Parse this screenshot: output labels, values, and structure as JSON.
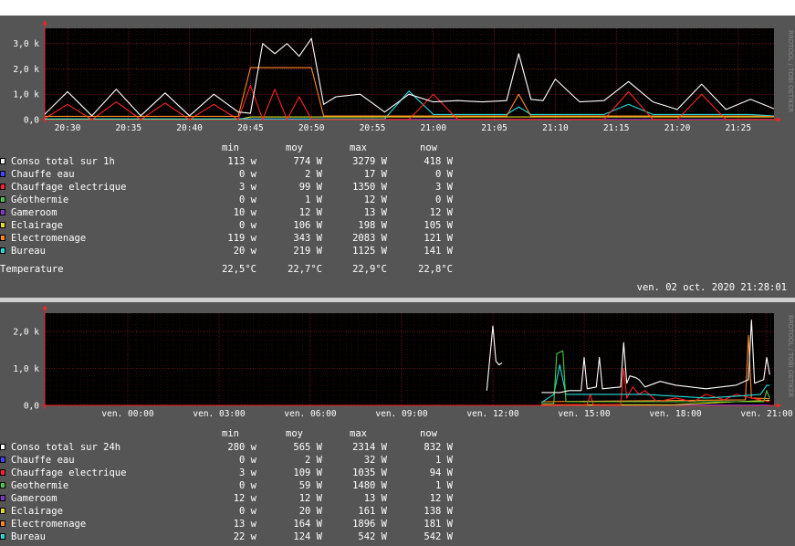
{
  "graphs": [
    {
      "id": "1h",
      "y_ticks": [
        "3,0 k",
        "2,0 k",
        "1,0 k",
        "0,0"
      ],
      "x_ticks": [
        "20:30",
        "20:35",
        "20:40",
        "20:45",
        "20:50",
        "20:55",
        "21:00",
        "21:05",
        "21:10",
        "21:15",
        "21:20",
        "21:25"
      ],
      "side_text": "RRDTOOL / TOBI OETIKER",
      "columns": [
        "min",
        "moy",
        "max",
        "now"
      ],
      "rows": [
        {
          "name": "Conso total sur 1h",
          "color": "#ffffff",
          "min": "113 w",
          "moy": "774 W",
          "max": "3279 W",
          "now": "418 W"
        },
        {
          "name": "Chauffe eau",
          "color": "#4444ff",
          "min": "0 w",
          "moy": "2 W",
          "max": "17 W",
          "now": "0 W"
        },
        {
          "name": "Chauffage electrique",
          "color": "#ff2222",
          "min": "3 w",
          "moy": "99 W",
          "max": "1350 W",
          "now": "3 W"
        },
        {
          "name": "Géothermie",
          "color": "#44cc44",
          "min": "0 w",
          "moy": "1 W",
          "max": "12 W",
          "now": "0 W"
        },
        {
          "name": "Gameroom",
          "color": "#8833cc",
          "min": "10 w",
          "moy": "12 W",
          "max": "13 W",
          "now": "12 W"
        },
        {
          "name": "Eclairage",
          "color": "#dddd22",
          "min": "0 w",
          "moy": "106 W",
          "max": "198 W",
          "now": "105 W"
        },
        {
          "name": "Electromenage",
          "color": "#ff8822",
          "min": "119 w",
          "moy": "343 W",
          "max": "2083 W",
          "now": "121 W"
        },
        {
          "name": "Bureau",
          "color": "#22dddd",
          "min": "20 w",
          "moy": "219 W",
          "max": "1125 W",
          "now": "141 W"
        }
      ],
      "temperature": {
        "label": "Temperature",
        "min": "22,5°C",
        "moy": "22,7°C",
        "max": "22,9°C",
        "now": "22,8°C"
      },
      "timestamp": "ven. 02 oct. 2020 21:28:01"
    },
    {
      "id": "24h",
      "y_ticks": [
        "2,0 k",
        "1,0 k",
        "0,0"
      ],
      "x_ticks": [
        "ven. 00:00",
        "ven. 03:00",
        "ven. 06:00",
        "ven. 09:00",
        "ven. 12:00",
        "ven. 15:00",
        "ven. 18:00",
        "ven. 21:00"
      ],
      "side_text": "RRDTOOL / TOBI OETIKER",
      "columns": [
        "min",
        "moy",
        "max",
        "now"
      ],
      "rows": [
        {
          "name": "Conso total sur 24h",
          "color": "#ffffff",
          "min": "280 w",
          "moy": "565 W",
          "max": "2314 W",
          "now": "832 W"
        },
        {
          "name": "Chauffe eau",
          "color": "#4444ff",
          "min": "0 w",
          "moy": "2 W",
          "max": "32 W",
          "now": "1 W"
        },
        {
          "name": "Chauffage electrique",
          "color": "#ff2222",
          "min": "3 w",
          "moy": "109 W",
          "max": "1035 W",
          "now": "94 W"
        },
        {
          "name": "Geothermie",
          "color": "#44cc44",
          "min": "0 w",
          "moy": "59 W",
          "max": "1480 W",
          "now": "1 W"
        },
        {
          "name": "Gameroom",
          "color": "#8833cc",
          "min": "12 w",
          "moy": "12 W",
          "max": "13 W",
          "now": "12 W"
        },
        {
          "name": "Eclairage",
          "color": "#dddd22",
          "min": "0 w",
          "moy": "20 W",
          "max": "161 W",
          "now": "138 W"
        },
        {
          "name": "Electromenage",
          "color": "#ff8822",
          "min": "13 w",
          "moy": "164 W",
          "max": "1896 W",
          "now": "181 W"
        },
        {
          "name": "Bureau",
          "color": "#22dddd",
          "min": "22 w",
          "moy": "124 W",
          "max": "542 W",
          "now": "542 W"
        }
      ]
    }
  ],
  "chart_data": [
    {
      "type": "line",
      "ylim": [
        0,
        3600
      ],
      "x_unit": "time",
      "x": [
        "20:28",
        "20:30",
        "20:32",
        "20:34",
        "20:36",
        "20:38",
        "20:40",
        "20:42",
        "20:44",
        "20:45",
        "20:46",
        "20:47",
        "20:48",
        "20:49",
        "20:50",
        "20:51",
        "20:52",
        "20:54",
        "20:56",
        "20:58",
        "21:00",
        "21:02",
        "21:04",
        "21:06",
        "21:07",
        "21:08",
        "21:09",
        "21:10",
        "21:12",
        "21:14",
        "21:16",
        "21:18",
        "21:20",
        "21:22",
        "21:24",
        "21:26",
        "21:28"
      ],
      "series": [
        {
          "name": "Conso total sur 1h",
          "color": "#ffffff",
          "values": [
            150,
            1100,
            150,
            1200,
            150,
            1050,
            150,
            1000,
            300,
            250,
            3000,
            2600,
            3000,
            2500,
            3200,
            600,
            900,
            1000,
            300,
            1000,
            700,
            750,
            700,
            750,
            2600,
            800,
            750,
            1600,
            700,
            750,
            1500,
            700,
            400,
            1400,
            400,
            800,
            418
          ]
        },
        {
          "name": "Electromenage",
          "color": "#ff8822",
          "values": [
            130,
            130,
            130,
            130,
            130,
            130,
            130,
            130,
            130,
            2050,
            2050,
            2050,
            2050,
            2050,
            2050,
            140,
            140,
            140,
            140,
            140,
            140,
            140,
            140,
            140,
            1000,
            140,
            140,
            140,
            140,
            140,
            140,
            140,
            140,
            140,
            140,
            140,
            121
          ]
        },
        {
          "name": "Chauffage electrique",
          "color": "#ff2222",
          "values": [
            3,
            600,
            3,
            700,
            3,
            650,
            3,
            600,
            3,
            1350,
            3,
            1200,
            3,
            900,
            3,
            3,
            3,
            3,
            3,
            3,
            1000,
            3,
            3,
            3,
            3,
            3,
            3,
            3,
            3,
            3,
            1100,
            3,
            3,
            1000,
            3,
            3,
            3
          ]
        },
        {
          "name": "Bureau",
          "color": "#22dddd",
          "values": [
            30,
            30,
            30,
            30,
            30,
            30,
            30,
            30,
            30,
            30,
            30,
            30,
            30,
            30,
            30,
            30,
            30,
            30,
            30,
            1125,
            200,
            200,
            200,
            200,
            500,
            200,
            200,
            200,
            200,
            200,
            600,
            200,
            200,
            200,
            200,
            200,
            141
          ]
        },
        {
          "name": "Eclairage",
          "color": "#dddd22",
          "values": [
            0,
            0,
            0,
            0,
            0,
            0,
            0,
            0,
            0,
            105,
            105,
            105,
            105,
            105,
            105,
            105,
            105,
            105,
            105,
            105,
            105,
            105,
            105,
            105,
            105,
            105,
            105,
            105,
            105,
            105,
            105,
            105,
            105,
            105,
            105,
            105,
            105
          ]
        },
        {
          "name": "Gameroom",
          "color": "#8833cc",
          "values": [
            12,
            12,
            12,
            12,
            12,
            12,
            12,
            12,
            12,
            12,
            12,
            12,
            12,
            12,
            12,
            12,
            12,
            12,
            12,
            12,
            12,
            12,
            12,
            12,
            12,
            12,
            12,
            12,
            12,
            12,
            12,
            12,
            12,
            12,
            12,
            12,
            12
          ]
        }
      ]
    },
    {
      "type": "line",
      "ylim": [
        0,
        2500
      ],
      "x_unit": "hour",
      "x": [
        -2,
        10.5,
        11,
        11.2,
        11.4,
        11.6,
        11.8,
        12,
        12.2,
        13,
        13.2,
        13.4,
        13.6,
        13.8,
        14,
        14.2,
        14.6,
        15,
        15.2,
        15.4,
        15.6,
        16,
        16.2,
        16.4,
        16.6,
        17,
        17.2,
        17.4,
        17.6,
        18,
        18.5,
        19,
        19.5,
        20,
        20.2,
        20.4,
        20.6,
        20.8,
        21,
        21.1
      ],
      "series": [
        {
          "name": "Conso total sur 24h",
          "color": "#ffffff",
          "values": [
            null,
            null,
            null,
            null,
            null,
            null,
            null,
            null,
            null,
            null,
            null,
            null,
            null,
            null,
            null,
            null,
            null,
            null,
            null,
            null,
            null,
            null,
            null,
            null,
            null,
            null,
            null,
            null,
            null,
            null,
            null,
            null,
            null,
            null,
            null,
            null,
            null,
            null,
            null,
            null
          ]
        },
        {
          "name": "Electromenage",
          "color": "#ff8822",
          "values": [
            null,
            null,
            null,
            null,
            null,
            null,
            null,
            null,
            null,
            null,
            null,
            null,
            null,
            null,
            null,
            null,
            null,
            null,
            null,
            null,
            null,
            null,
            null,
            null,
            null,
            null,
            null,
            null,
            null,
            null,
            null,
            null,
            null,
            null,
            null,
            null,
            null,
            null,
            null,
            null
          ]
        }
      ],
      "segments": [
        {
          "name": "Conso total sur 24h",
          "color": "#ffffff",
          "points": [
            [
              11.8,
              400
            ],
            [
              12,
              2150
            ],
            [
              12.1,
              1200
            ],
            [
              12.2,
              1100
            ],
            [
              12.3,
              1150
            ]
          ]
        },
        {
          "name": "Conso total sur 24h",
          "color": "#ffffff",
          "points": [
            [
              13.6,
              350
            ],
            [
              14.2,
              350
            ],
            [
              14.5,
              400
            ],
            [
              14.9,
              400
            ],
            [
              15,
              1300
            ],
            [
              15.1,
              450
            ],
            [
              15.4,
              500
            ],
            [
              15.5,
              1300
            ],
            [
              15.6,
              450
            ],
            [
              16.2,
              500
            ],
            [
              16.3,
              1700
            ],
            [
              16.4,
              600
            ],
            [
              16.5,
              800
            ],
            [
              16.7,
              750
            ],
            [
              16.8,
              700
            ],
            [
              17,
              500
            ],
            [
              17.5,
              650
            ],
            [
              18,
              550
            ],
            [
              18.5,
              500
            ],
            [
              19,
              450
            ],
            [
              19.5,
              500
            ],
            [
              20,
              550
            ],
            [
              20.4,
              700
            ],
            [
              20.5,
              2314
            ],
            [
              20.6,
              600
            ],
            [
              20.9,
              700
            ],
            [
              21,
              1300
            ],
            [
              21.1,
              832
            ]
          ]
        },
        {
          "name": "Geothermie",
          "color": "#44cc44",
          "points": [
            [
              13.6,
              50
            ],
            [
              14,
              50
            ],
            [
              14.1,
              1400
            ],
            [
              14.3,
              1480
            ],
            [
              14.4,
              100
            ],
            [
              15,
              100
            ],
            [
              20.9,
              100
            ],
            [
              21,
              400
            ],
            [
              21.1,
              200
            ]
          ]
        },
        {
          "name": "Bureau",
          "color": "#22dddd",
          "points": [
            [
              13.6,
              80
            ],
            [
              14,
              300
            ],
            [
              14.2,
              1100
            ],
            [
              14.4,
              300
            ],
            [
              16,
              300
            ],
            [
              17,
              300
            ],
            [
              18,
              250
            ],
            [
              19,
              200
            ],
            [
              20,
              250
            ],
            [
              20.8,
              300
            ],
            [
              21,
              542
            ],
            [
              21.1,
              542
            ]
          ]
        },
        {
          "name": "Chauffage electrique",
          "color": "#ff2222",
          "points": [
            [
              13.6,
              20
            ],
            [
              15.1,
              20
            ],
            [
              15.2,
              300
            ],
            [
              15.3,
              20
            ],
            [
              16.2,
              20
            ],
            [
              16.3,
              1000
            ],
            [
              16.4,
              200
            ],
            [
              16.6,
              500
            ],
            [
              16.8,
              300
            ],
            [
              17,
              400
            ],
            [
              17.4,
              100
            ],
            [
              18,
              200
            ],
            [
              18.6,
              100
            ],
            [
              19,
              300
            ],
            [
              19.6,
              150
            ],
            [
              20,
              300
            ],
            [
              20.5,
              200
            ],
            [
              21.1,
              94
            ]
          ]
        },
        {
          "name": "Electromenage",
          "color": "#ff8822",
          "points": [
            [
              13.6,
              100
            ],
            [
              20.3,
              150
            ],
            [
              20.4,
              1896
            ],
            [
              20.5,
              200
            ],
            [
              21.1,
              181
            ]
          ]
        },
        {
          "name": "Eclairage",
          "color": "#dddd22",
          "points": [
            [
              13.6,
              10
            ],
            [
              18,
              20
            ],
            [
              20,
              100
            ],
            [
              21.1,
              138
            ]
          ]
        },
        {
          "name": "Gameroom",
          "color": "#8833cc",
          "points": [
            [
              13.6,
              12
            ],
            [
              21.1,
              12
            ]
          ]
        }
      ]
    }
  ]
}
